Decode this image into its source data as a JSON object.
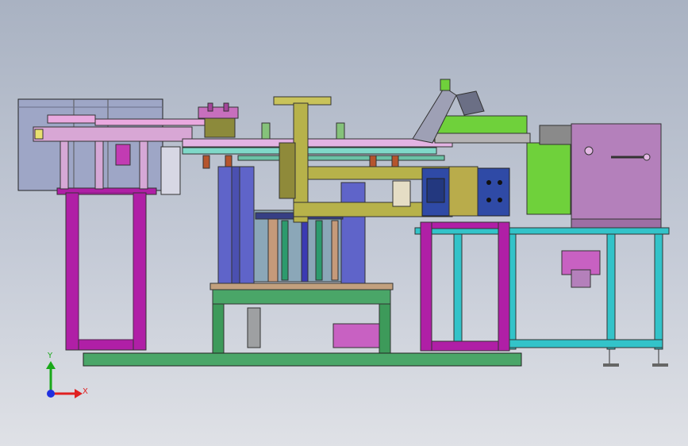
{
  "viewport": {
    "background_top": "#a9b2c2",
    "background_bottom": "#dfe1e6"
  },
  "triad": {
    "x_label": "X",
    "y_label": "Y",
    "x_color": "#e02020",
    "y_color": "#1aa81a",
    "z_color": "#2030e0"
  },
  "colors": {
    "magenta_frame": "#b01fa6",
    "teal_frame": "#33c3c9",
    "green_frame": "#3d9a5a",
    "olive_arm": "#b7b24a",
    "blue_column": "#5f64c9",
    "navy_block": "#2f4aa6",
    "lime_box": "#6fd13b",
    "mauve_housing": "#b480bb",
    "pink_rail": "#e9a9df",
    "cyan_tubes": "#7fd8c8",
    "tan_plate": "#c59a7a",
    "hopper_magenta": "#c861c2"
  }
}
